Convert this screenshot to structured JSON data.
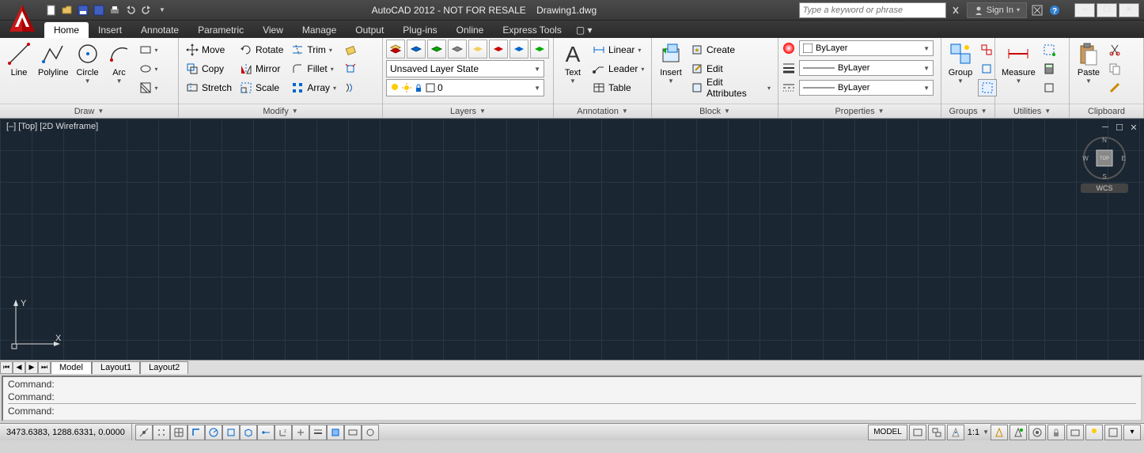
{
  "title": {
    "app": "AutoCAD 2012 - NOT FOR RESALE",
    "file": "Drawing1.dwg"
  },
  "search": {
    "placeholder": "Type a keyword or phrase"
  },
  "signin": {
    "label": "Sign In"
  },
  "menus": [
    "Home",
    "Insert",
    "Annotate",
    "Parametric",
    "View",
    "Manage",
    "Output",
    "Plug-ins",
    "Online",
    "Express Tools"
  ],
  "active_menu": 0,
  "ribbon": {
    "draw": {
      "title": "Draw",
      "items": {
        "line": "Line",
        "polyline": "Polyline",
        "circle": "Circle",
        "arc": "Arc"
      }
    },
    "modify": {
      "title": "Modify",
      "items": {
        "move": "Move",
        "rotate": "Rotate",
        "trim": "Trim",
        "copy": "Copy",
        "mirror": "Mirror",
        "fillet": "Fillet",
        "stretch": "Stretch",
        "scale": "Scale",
        "array": "Array"
      }
    },
    "layers": {
      "title": "Layers",
      "state": "Unsaved Layer State",
      "current": "0"
    },
    "annotation": {
      "title": "Annotation",
      "items": {
        "text": "Text",
        "linear": "Linear",
        "leader": "Leader",
        "table": "Table"
      }
    },
    "block": {
      "title": "Block",
      "items": {
        "insert": "Insert",
        "create": "Create",
        "edit": "Edit",
        "editattr": "Edit Attributes"
      }
    },
    "properties": {
      "title": "Properties",
      "color": "ByLayer",
      "lineweight": "ByLayer",
      "linetype": "ByLayer"
    },
    "groups": {
      "title": "Groups",
      "group": "Group"
    },
    "utilities": {
      "title": "Utilities",
      "measure": "Measure"
    },
    "clipboard": {
      "title": "Clipboard",
      "paste": "Paste"
    }
  },
  "viewport": {
    "label": "[–] [Top] [2D Wireframe]",
    "wcs": "WCS",
    "cube": {
      "top": "TOP",
      "n": "N",
      "s": "S",
      "e": "E",
      "w": "W"
    }
  },
  "tabs": [
    "Model",
    "Layout1",
    "Layout2"
  ],
  "command": {
    "history": [
      "Command:",
      "Command:"
    ],
    "prompt": "Command:"
  },
  "status": {
    "coords": "3473.6383, 1288.6331, 0.0000",
    "model": "MODEL",
    "scale": "1:1"
  }
}
